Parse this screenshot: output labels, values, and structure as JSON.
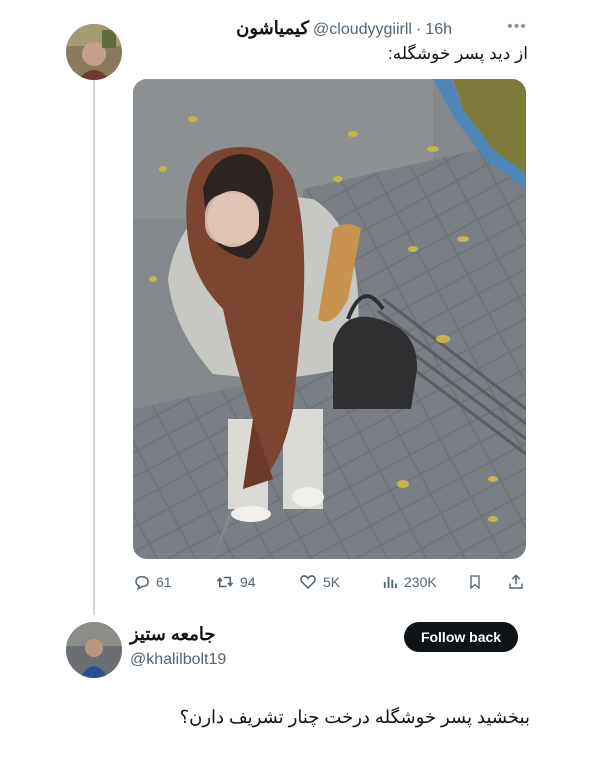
{
  "tweet": {
    "author_name": "کیمیاشون",
    "handle": "@cloudyygiirll",
    "separator": "·",
    "time": "16h",
    "more_icon": "more-horizontal-icon",
    "text": "از دید پسر خوشگله:",
    "actions": {
      "replies": "61",
      "retweets": "94",
      "likes": "5K",
      "views": "230K"
    }
  },
  "reply": {
    "author_name": "جامعه ستیز",
    "handle": "@khalilbolt19",
    "follow_label": "Follow back",
    "text": "ببخشید پسر خوشگله درخت چنار تشریف دارن؟"
  },
  "colors": {
    "text": "#0f1419",
    "secondary": "#536471",
    "thread_line": "#cfd9de",
    "button_bg": "#0f1419"
  }
}
